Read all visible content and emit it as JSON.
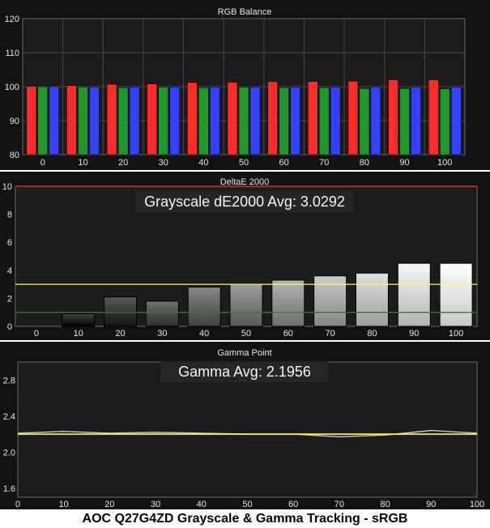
{
  "footer": "AOC Q27G4ZD Grayscale & Gamma Tracking - sRGB",
  "colors": {
    "panel_bg": "#121212",
    "plot_bg": "#1c1c1c",
    "border": "#6a6a6a",
    "grid": "#4a4a4a",
    "text": "#e8e8e8",
    "red": "#ff2a2a",
    "green": "#1f9a2a",
    "blue": "#3540ff",
    "yellow": "#ffff33",
    "dark_green": "#1a8a1a",
    "red_line": "#ff3333",
    "reference_line": "#c8c8c8"
  },
  "chart_data": [
    {
      "type": "bar",
      "title": "RGB Balance",
      "categories": [
        "0",
        "10",
        "20",
        "30",
        "40",
        "50",
        "60",
        "70",
        "80",
        "90",
        "100"
      ],
      "series": [
        {
          "name": "Red",
          "values": [
            100.1,
            100.3,
            100.7,
            100.8,
            101.2,
            101.3,
            101.5,
            101.5,
            101.6,
            102.0,
            102.0
          ]
        },
        {
          "name": "Green",
          "values": [
            100.0,
            99.9,
            99.7,
            99.8,
            99.7,
            99.8,
            99.7,
            99.7,
            99.5,
            99.5,
            99.4
          ]
        },
        {
          "name": "Blue",
          "values": [
            100.0,
            99.9,
            99.9,
            99.9,
            99.9,
            99.9,
            99.8,
            99.8,
            99.9,
            99.8,
            99.8
          ]
        }
      ],
      "ylim": [
        80,
        120
      ],
      "yticks": [
        80,
        90,
        100,
        110,
        120
      ],
      "grid": true
    },
    {
      "type": "bar",
      "title": "DeltaE 2000",
      "annotation": "Grayscale dE2000 Avg: 3.0292",
      "categories": [
        "0",
        "10",
        "20",
        "30",
        "40",
        "50",
        "60",
        "70",
        "80",
        "90",
        "100"
      ],
      "values": [
        0.0,
        0.9,
        2.1,
        1.8,
        2.8,
        3.0,
        3.3,
        3.6,
        3.8,
        4.5,
        4.5
      ],
      "gray_levels": [
        0,
        10,
        20,
        30,
        40,
        50,
        60,
        70,
        80,
        90,
        100
      ],
      "reference_lines": [
        {
          "value": 3,
          "color": "yellow"
        },
        {
          "value": 1,
          "color": "dark_green"
        },
        {
          "value": 10,
          "color": "red_line"
        }
      ],
      "ylim": [
        0,
        10
      ],
      "yticks": [
        0,
        2,
        4,
        6,
        8,
        10
      ],
      "grid": false
    },
    {
      "type": "line",
      "title": "Gamma Point",
      "annotation": "Gamma Avg: 2.1956",
      "x": [
        0,
        10,
        20,
        30,
        40,
        50,
        60,
        70,
        80,
        90,
        100
      ],
      "series": [
        {
          "values": [
            2.21,
            2.23,
            2.21,
            2.22,
            2.21,
            2.2,
            2.2,
            2.17,
            2.19,
            2.24,
            2.21
          ],
          "color": "reference_line"
        },
        {
          "values": [
            2.2,
            2.2,
            2.2,
            2.2,
            2.2,
            2.2,
            2.2,
            2.2,
            2.2,
            2.2,
            2.2
          ],
          "color": "yellow"
        }
      ],
      "xlim": [
        0,
        100
      ],
      "xticks": [
        0,
        10,
        20,
        30,
        40,
        50,
        60,
        70,
        80,
        90,
        100
      ],
      "ylim": [
        1.5,
        3.0
      ],
      "yticks": [
        1.6,
        2.0,
        2.4,
        2.8
      ],
      "grid": false
    }
  ]
}
